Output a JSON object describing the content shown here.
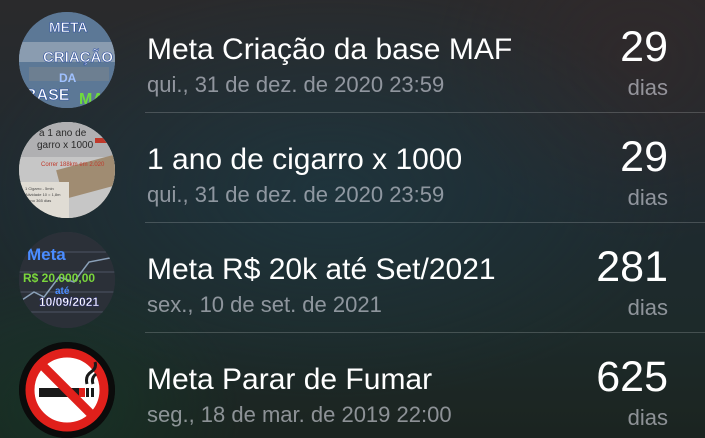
{
  "goals": [
    {
      "title": "Meta Criação da base MAF",
      "date": "qui., 31 de dez. de 2020 23:59",
      "count": "29",
      "unit": "dias",
      "image_icon": "maf-goal-image"
    },
    {
      "title": "1 ano de cigarro x 1000",
      "date": "qui., 31 de dez. de 2020 23:59",
      "count": "29",
      "unit": "dias",
      "image_icon": "cigarette-goal-image"
    },
    {
      "title": "Meta R$ 20k até Set/2021",
      "date": "sex., 10 de set. de 2021",
      "count": "281",
      "unit": "dias",
      "image_icon": "money-goal-image"
    },
    {
      "title": "Meta Parar de Fumar",
      "date": "seg., 18 de mar. de 2019 22:00",
      "count": "625",
      "unit": "dias",
      "image_icon": "no-smoking-icon"
    }
  ]
}
